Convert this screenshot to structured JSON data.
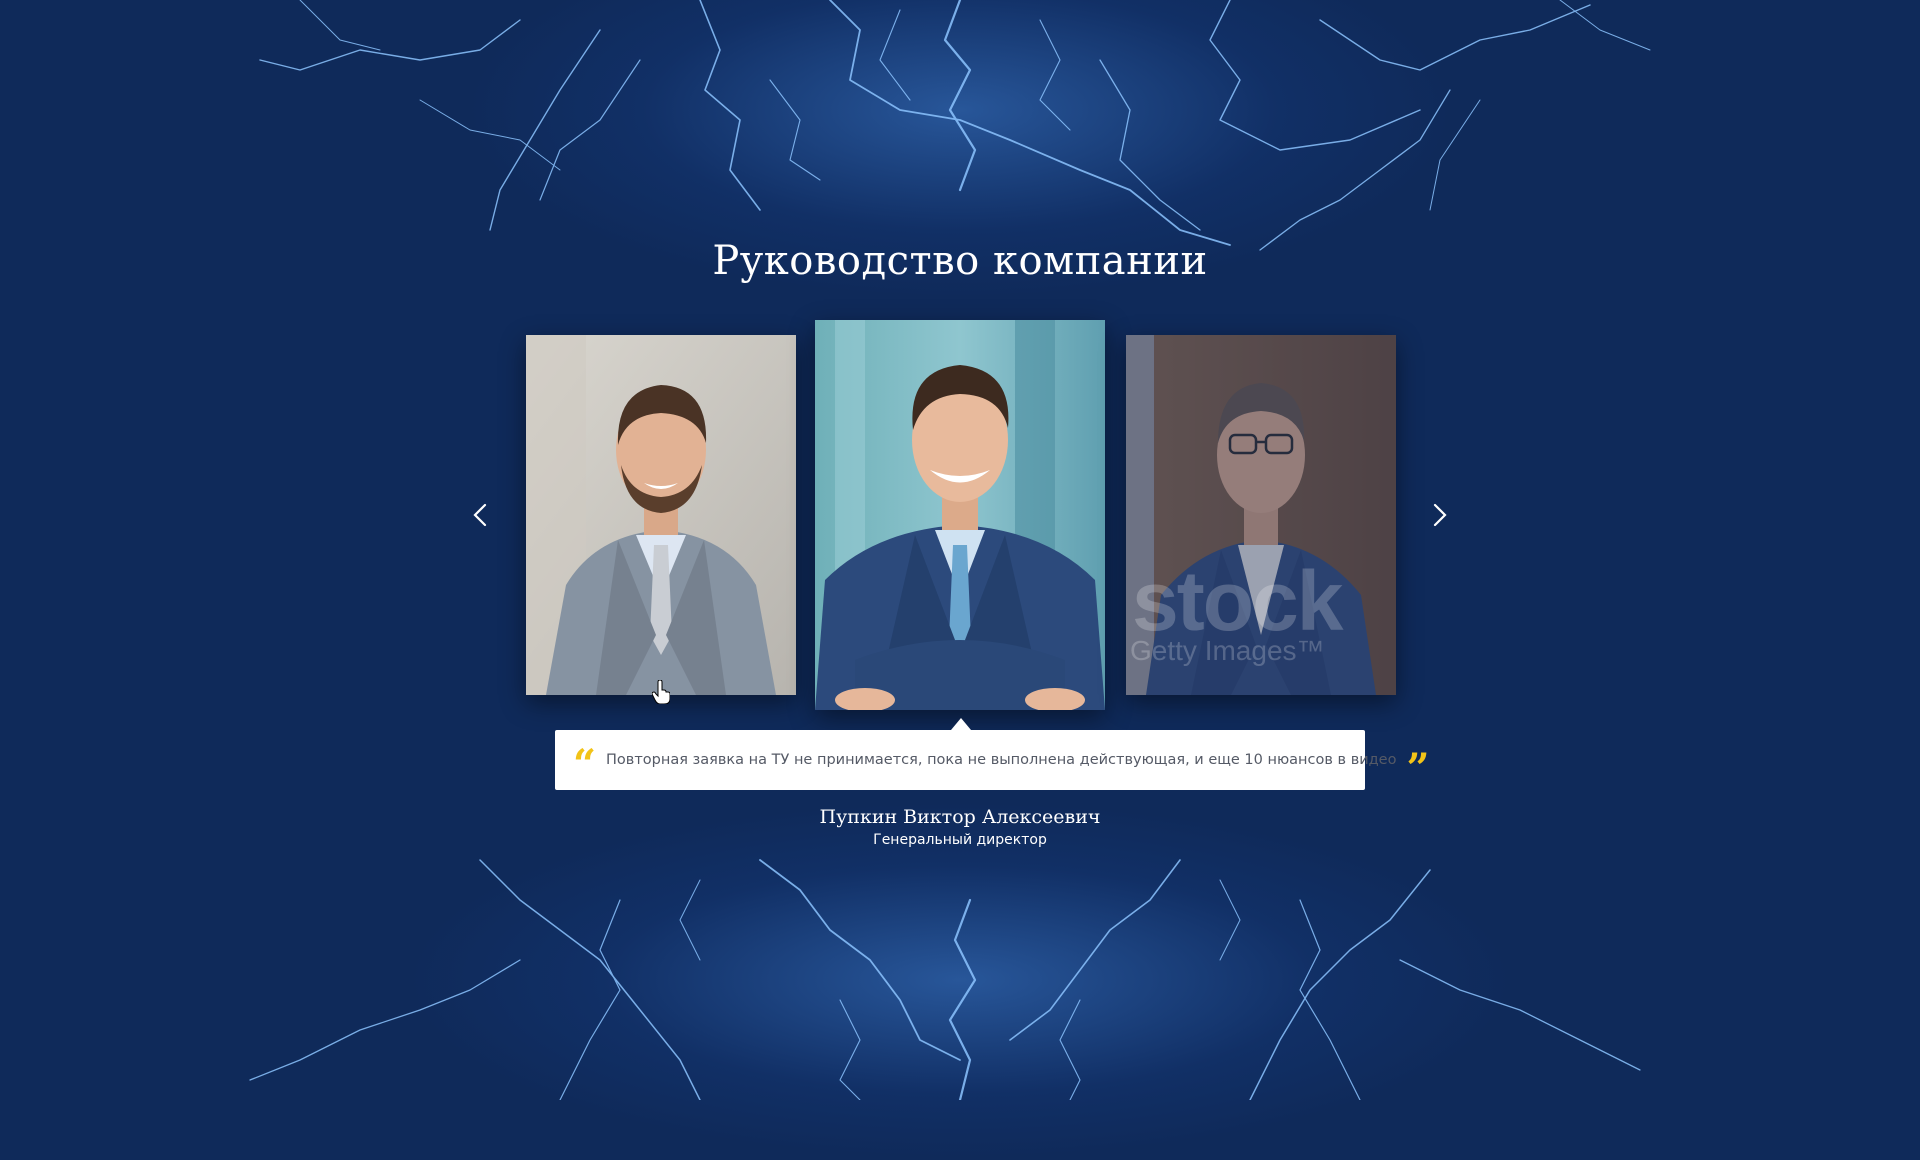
{
  "section": {
    "title": "Руководство компании"
  },
  "carousel": {
    "prev_icon": "chevron-left-icon",
    "next_icon": "chevron-right-icon",
    "slides": [
      {
        "photo": "portrait-bearded-man-grey-suit",
        "active": false
      },
      {
        "photo": "portrait-smiling-man-blue-suit",
        "active": true
      },
      {
        "photo": "portrait-man-glasses-blue-blazer",
        "active": false,
        "watermark": "stock",
        "watermark_sub": "Getty Images™"
      }
    ]
  },
  "testimonial": {
    "quote": "Повторная заявка на ТУ не принимается, пока не выполнена действующая, и еще 10 нюансов в видео",
    "open_mark": "“",
    "close_mark": "”",
    "name": "Пупкин Виктор Алексеевич",
    "role": "Генеральный директор"
  },
  "colors": {
    "background": "#0f2a5a",
    "lightning": "#8cc4ff",
    "quote_marks": "#f2c318",
    "quote_box": "#ffffff"
  }
}
